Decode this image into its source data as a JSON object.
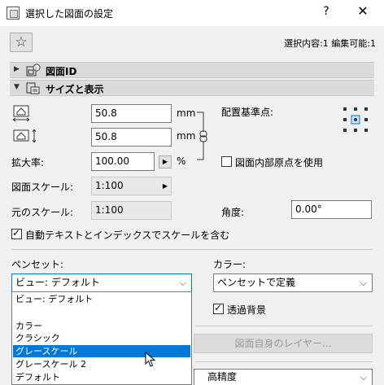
{
  "window": {
    "title": "選択した図面の設定",
    "help": "?",
    "close": "✕"
  },
  "toolbar": {
    "favorite": "☆",
    "selection_info": "選択内容:1 編集可能:1"
  },
  "sections": {
    "drawing_id": "図面ID",
    "size_display": "サイズと表示"
  },
  "size": {
    "width_value": "50.8",
    "height_value": "50.8",
    "unit_mm_1": "mm",
    "unit_mm_2": "mm",
    "scale_label": "拡大率:",
    "scale_value": "100.00",
    "scale_unit": "%",
    "drawing_scale_label": "図面スケール:",
    "drawing_scale_value": "1:100",
    "original_scale_label": "元のスケール:",
    "original_scale_value": "1:100",
    "anchor_label": "配置基準点:",
    "use_origin_label": "図面内部原点を使用",
    "use_origin_checked": false,
    "angle_label": "角度:",
    "angle_value": "0.00°",
    "auto_scale_label": "自動テキストとインデックスでスケールを含む",
    "auto_scale_checked": true
  },
  "pen": {
    "label": "ペンセット:",
    "value": "ビュー: デフォルト",
    "options": [
      "ビュー: デフォルト",
      "",
      "カラー",
      "クラシック",
      "グレースケール",
      "グレースケール 2",
      "デフォルト"
    ],
    "highlighted": "グレースケール"
  },
  "color": {
    "label": "カラー:",
    "value": "ペンセットで定義",
    "transparent_label": "透過背景",
    "transparent_checked": true
  },
  "layers_button": "図面自身のレイヤー...",
  "quality_value": "高精度"
}
